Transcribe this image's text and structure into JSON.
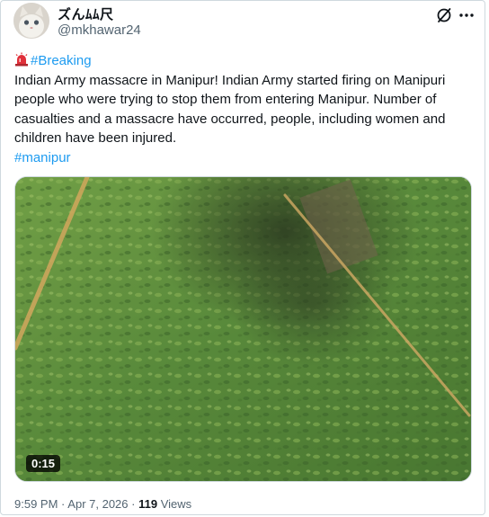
{
  "author": {
    "display_name": "ズんﾑﾑ尺",
    "handle": "@mkhawar24"
  },
  "tweet": {
    "hashtag_breaking": "#Breaking",
    "lines": [
      "Indian Army massacre in Manipur!  Indian Army started firing on Manipuri",
      "people who were trying to stop them from entering Manipur.  Number of",
      "casualties and a massacre have occurred, people, including women and",
      "children have been injured."
    ],
    "hashtag_manipur": "#manipur"
  },
  "media": {
    "type": "video",
    "duration": "0:15"
  },
  "meta": {
    "time": "9:59 PM",
    "separator": "·",
    "date": "Apr 7, 2026",
    "views_count": "119",
    "views_label": "Views"
  },
  "icons": [
    "grok-icon",
    "more-icon",
    "rotating-light-icon"
  ],
  "colors": {
    "link": "#1d9bf0",
    "secondary_text": "#536471",
    "primary_text": "#0f1419"
  }
}
